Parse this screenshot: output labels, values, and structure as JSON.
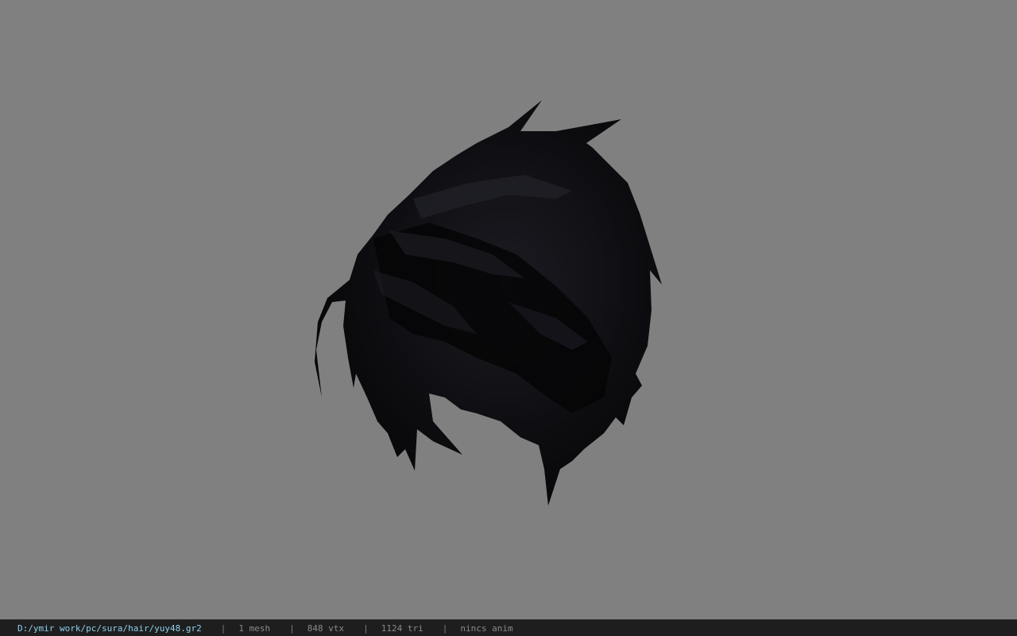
{
  "viewport": {
    "background_color": "#808080",
    "model_color": "#0a0a0c",
    "model_highlight_color": "#1c1c24"
  },
  "status_bar": {
    "file_path": "D:/ymir work/pc/sura/hair/yuy48.gr2",
    "separator": "|",
    "mesh_count": "1 mesh",
    "vertex_count": "848 vtx",
    "triangle_count": "1124 tri",
    "anim_status": "nincs anim",
    "path_color": "#8fd0ec",
    "text_color": "#8a8a8a",
    "background_color": "#1e1e1e"
  }
}
